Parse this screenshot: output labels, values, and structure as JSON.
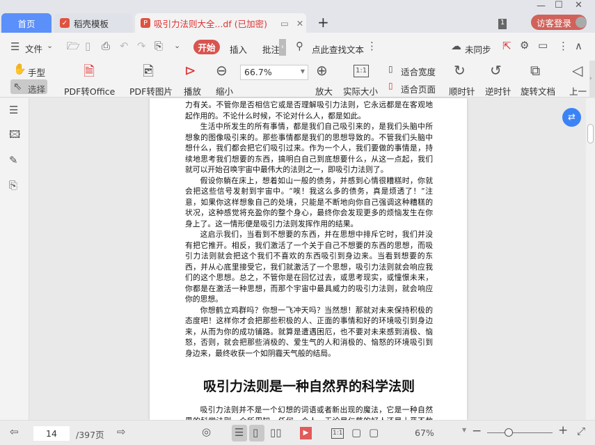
{
  "tabs": {
    "home": "首页",
    "template": "稻壳模板",
    "document": "吸引力法则大全...df (已加密)"
  },
  "window": {
    "count_badge": "1",
    "login": "访客登录"
  },
  "toolbar1": {
    "file": "文件",
    "start": "开始",
    "insert": "插入",
    "annotate": "批注",
    "search": "点此查找文本",
    "sync": "未同步"
  },
  "toolbar2": {
    "hand": "手型",
    "select": "选择",
    "pdf_to_office": "PDF转Office",
    "pdf_to_image": "PDF转图片",
    "play": "播放",
    "zoom_out": "缩小",
    "zoom_value": "66.7%",
    "zoom_in": "放大",
    "actual_size": "实际大小",
    "fit_width": "适合宽度",
    "fit_page": "适合页面",
    "clockwise": "顺时针",
    "counterclockwise": "逆时针",
    "rotate_doc": "旋转文档",
    "prev": "上一"
  },
  "document": {
    "paragraphs": [
      "力有关。不管你是否相信它或是否理解吸引力法则，它永远都是在客观地起作用的。不论什么时候，不论对什么人，都是如此。",
      "生活中所发生的所有事情，都是我们自己吸引来的，是我们头脑中所想象的图像吸引来的。那些事情都是我们的思想导致的。不管我们头脑中想什么，我们都会把它们吸引过来。作为一个人，我们要做的事情是，持续地思考我们想要的东西，搞明白自己到底想要什么，从这一点起，我们就可以开始召唤宇宙中最伟大的法则之一，即吸引力法则了。",
      "假设你躺在床上，想着如山一般的债务，并感到心情很糟糕时，你就会把这些信号发射到宇宙中。“唉！我这么多的债务，真是烦透了！”注意，如果你这样想象自己的处境，只能是不断地向你自己强调这种糟糕的状况，这种感觉将充盈你的整个身心，最终你会发现更多的烦恼发生在你身上了。这一情形便是吸引力法则发挥作用的结果。",
      "这启示我们，当看到不想要的东西，并在思想中排斥它时，我们并没有把它推开。相反，我们激活了一个关于自己不想要的东西的思想，而吸引力法则就会把这个我们不喜欢的东西吸引到身边来。当看到想要的东西，并从心底里接受它，我们就激活了一个思想，吸引力法则就会响应我们的这个思想。总之，不管你是在回忆过去，或思考现实，或憧憬未来，你都是在激活一种思想，而那个宇宙中最具威力的吸引力法则，就会响应你的思想。",
      "你想鹤立鸡群吗？你想一飞冲天吗？当然想！那就对未来保持积极的态度吧！这样你才会把那些积极的人、正面的事情和好的环境吸引到身边来，从而为你的成功铺路。就算是遭遇困厄，也不要对未来感到消极、恼怒，否则，就会把那些消极的、爱生气的人和消极的、恼怒的环境吸引到身边来，最终收获一个如阴霾天气般的结局。"
    ],
    "heading": "吸引力法则是一种自然界的科学法则",
    "after": "吸引力法则并不是一个幻想的词语或者新出现的魔法，它是一种自然界的科学法则。众所周知，任何一个人，无论是仁慈的好人还是十恶不赦的坏蛋，无论"
  },
  "status": {
    "current_page": "14",
    "total_pages": "/397页",
    "zoom": "67%"
  }
}
